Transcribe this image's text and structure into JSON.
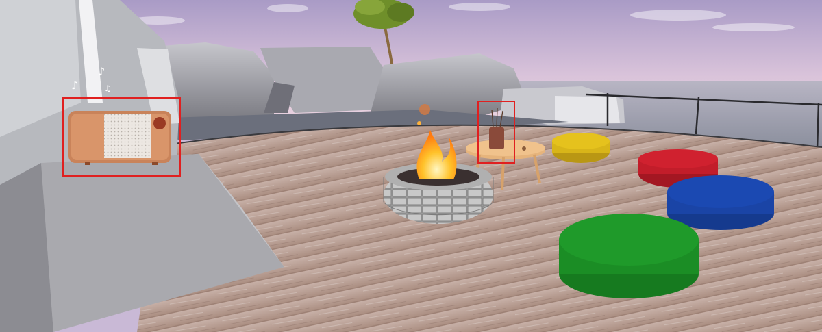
{
  "scene": {
    "type": "3d-virtual-rooftop-lounge",
    "sky_colors": [
      "#a99bc6",
      "#d9c3da",
      "#f0d8e2"
    ],
    "water_color": "#7c8394",
    "deck_color": "#b89f93"
  },
  "highlights": [
    {
      "name": "radio-speaker",
      "color": "#e02020"
    },
    {
      "name": "aroma-diffuser",
      "color": "#e02020"
    }
  ],
  "objects": {
    "radio": {
      "icon": "radio-speaker-icon",
      "body_color": "#c9835a",
      "grille_color": "#ece7e2",
      "knob_color": "#9a3a24",
      "music_notes": [
        "♪",
        "♪",
        "♫"
      ]
    },
    "fire_pit": {
      "stone_color": "#9b9b9b",
      "flame_color": "#ffb21a"
    },
    "side_table": {
      "top_color": "#e6b47c",
      "item": "diffuser",
      "item_color": "#8a4a3a"
    },
    "poufs": [
      {
        "color": "#e5c21d"
      },
      {
        "color": "#d0212f"
      },
      {
        "color": "#1b49b2"
      },
      {
        "color": "#1f9a2a"
      }
    ],
    "palm_tree": {
      "leaf_color": "#6f8f2a"
    }
  }
}
